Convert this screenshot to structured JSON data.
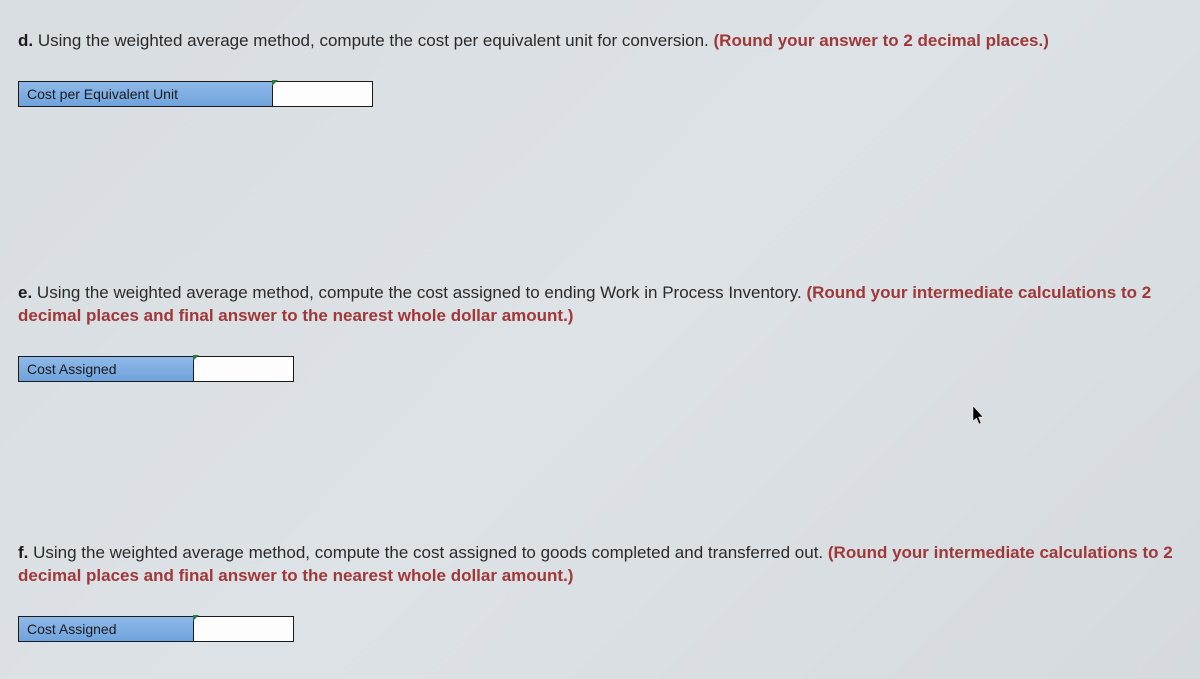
{
  "questions": {
    "d": {
      "label": "d.",
      "text": " Using the weighted average method, compute the cost per equivalent unit for conversion. ",
      "instruction": "(Round your answer to 2 decimal places.)",
      "answer_label": "Cost per Equivalent Unit",
      "answer_value": ""
    },
    "e": {
      "label": "e.",
      "text": " Using the weighted average method, compute the cost assigned to ending Work in Process Inventory. ",
      "instruction": "(Round your intermediate calculations to 2 decimal places and final answer to the nearest whole dollar amount.)",
      "answer_label": "Cost Assigned",
      "answer_value": ""
    },
    "f": {
      "label": "f.",
      "text": " Using the weighted average method, compute the cost assigned to goods completed and transferred out. ",
      "instruction": "(Round your intermediate calculations to 2 decimal places and final answer to the nearest whole dollar amount.)",
      "answer_label": "Cost Assigned",
      "answer_value": ""
    }
  }
}
